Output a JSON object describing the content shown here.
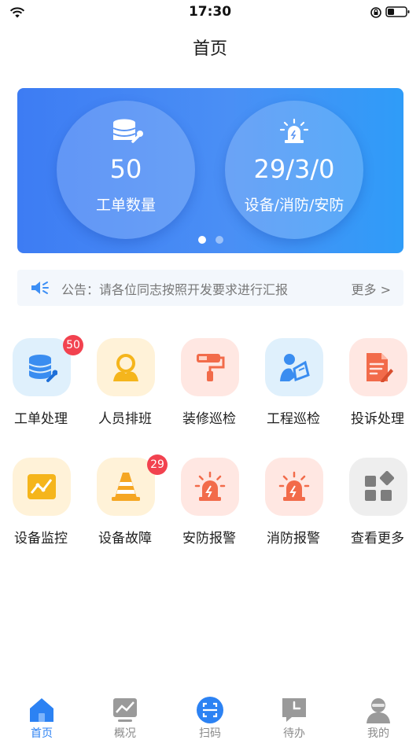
{
  "status": {
    "time": "17:30"
  },
  "page": {
    "title": "首页"
  },
  "banner": {
    "cards": [
      {
        "value": "50",
        "label": "工单数量",
        "icon": "database-wrench-icon"
      },
      {
        "value": "29/3/0",
        "label": "设备/消防/安防",
        "icon": "alarm-light-icon"
      }
    ],
    "active_dot": 0,
    "dot_count": 2
  },
  "notice": {
    "prefix": "公告：",
    "text": "请各位同志按照开发要求进行汇报",
    "more": "更多 >"
  },
  "grid": [
    {
      "label": "工单处理",
      "icon": "database-wrench-icon",
      "badge": "50"
    },
    {
      "label": "人员排班",
      "icon": "people-icon",
      "badge": ""
    },
    {
      "label": "装修巡检",
      "icon": "paint-roller-icon",
      "badge": ""
    },
    {
      "label": "工程巡检",
      "icon": "engineer-icon",
      "badge": ""
    },
    {
      "label": "投诉处理",
      "icon": "document-edit-icon",
      "badge": ""
    },
    {
      "label": "设备监控",
      "icon": "chart-monitor-icon",
      "badge": ""
    },
    {
      "label": "设备故障",
      "icon": "traffic-cone-icon",
      "badge": "29"
    },
    {
      "label": "安防报警",
      "icon": "alarm-light-icon",
      "badge": ""
    },
    {
      "label": "消防报警",
      "icon": "alarm-light-icon",
      "badge": ""
    },
    {
      "label": "查看更多",
      "icon": "apps-more-icon",
      "badge": ""
    }
  ],
  "tabs": [
    {
      "label": "首页",
      "icon": "home-icon",
      "active": true
    },
    {
      "label": "概况",
      "icon": "chart-icon",
      "active": false
    },
    {
      "label": "扫码",
      "icon": "scan-icon",
      "active": false
    },
    {
      "label": "待办",
      "icon": "todo-icon",
      "active": false
    },
    {
      "label": "我的",
      "icon": "user-icon",
      "active": false
    }
  ],
  "colors": {
    "accent": "#2c82f3",
    "badge": "#f2424f",
    "banner_start": "#3d7cf3",
    "banner_end": "#2f9cf8"
  }
}
